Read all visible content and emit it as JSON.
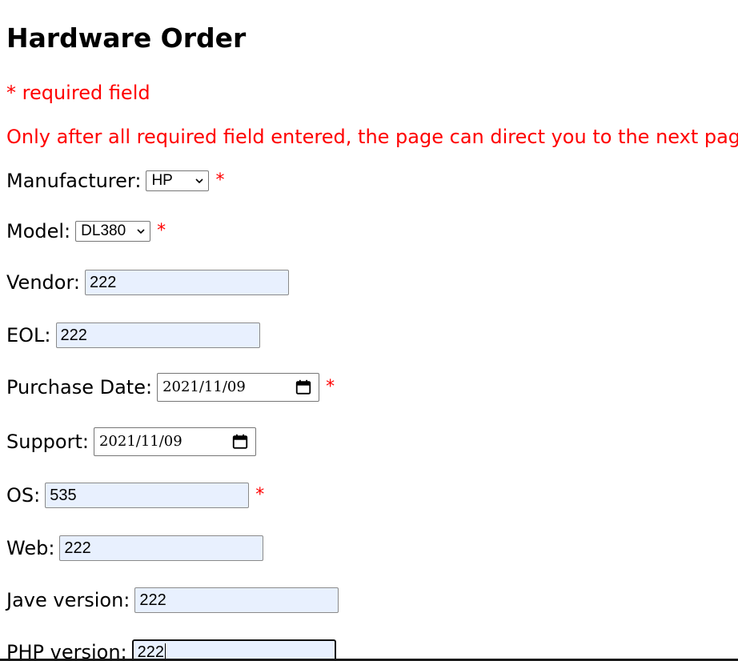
{
  "page": {
    "title": "Hardware Order",
    "required_note": "* required field",
    "instruction": "Only after all required field entered, the page can direct you to the next page."
  },
  "form": {
    "manufacturer": {
      "label": "Manufacturer:",
      "value": "HP",
      "required_mark": "*"
    },
    "model": {
      "label": "Model:",
      "value": "DL380",
      "required_mark": "*"
    },
    "vendor": {
      "label": "Vendor:",
      "value": "222"
    },
    "eol": {
      "label": "EOL:",
      "value": "222"
    },
    "purchase_date": {
      "label": "Purchase Date:",
      "value": "2021/11/09",
      "required_mark": "*"
    },
    "support": {
      "label": "Support:",
      "value": "2021/11/09"
    },
    "os": {
      "label": "OS:",
      "value": "535",
      "required_mark": "*"
    },
    "web": {
      "label": "Web:",
      "value": "222"
    },
    "java_version": {
      "label": "Jave version:",
      "value": "222"
    },
    "php_version": {
      "label": "PHP version:",
      "value": "222"
    }
  },
  "icons": {
    "dropdown": "chevron-down-icon",
    "date_picker": "calendar-icon"
  },
  "colors": {
    "required": "#ff0000",
    "autofill_bg": "#e8f0fe",
    "text": "#000000"
  }
}
